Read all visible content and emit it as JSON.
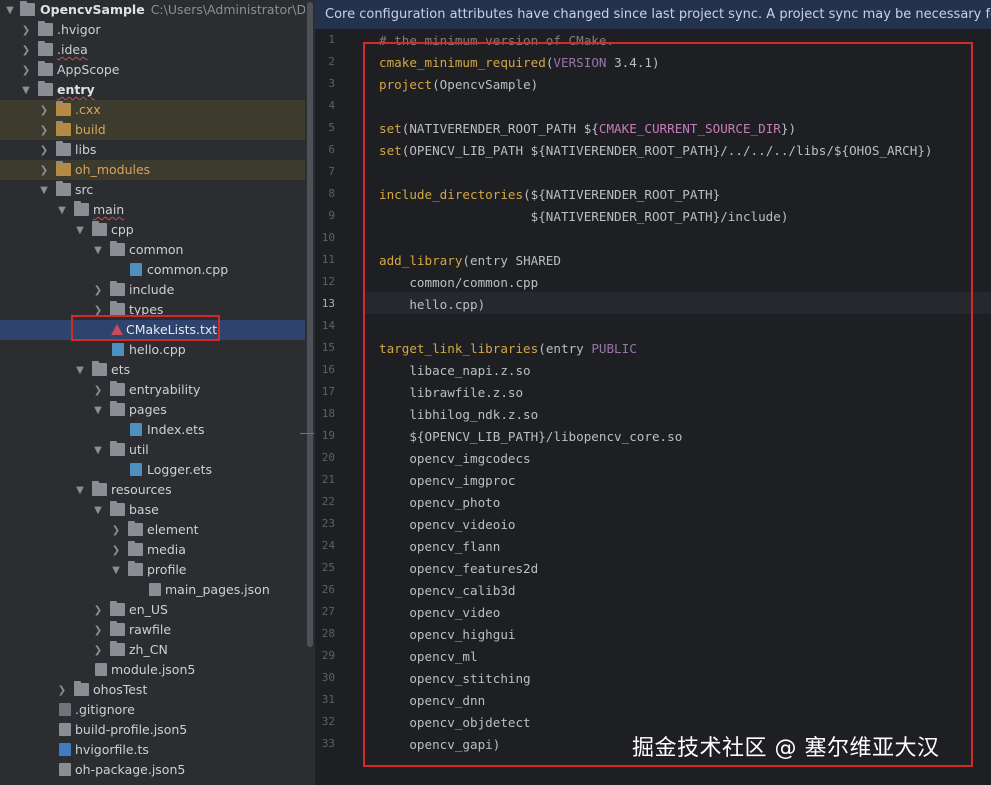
{
  "project_tree": {
    "root": {
      "name": "OpencvSample",
      "path": "C:\\Users\\Administrator\\DevEco"
    },
    "items": [
      {
        "label": ".hvigor"
      },
      {
        "label": ".idea"
      },
      {
        "label": "AppScope"
      },
      {
        "label": "entry"
      },
      {
        "label": ".cxx"
      },
      {
        "label": "build"
      },
      {
        "label": "libs"
      },
      {
        "label": "oh_modules"
      },
      {
        "label": "src"
      },
      {
        "label": "main"
      },
      {
        "label": "cpp"
      },
      {
        "label": "common"
      },
      {
        "label": "common.cpp"
      },
      {
        "label": "include"
      },
      {
        "label": "types"
      },
      {
        "label": "CMakeLists.txt"
      },
      {
        "label": "hello.cpp"
      },
      {
        "label": "ets"
      },
      {
        "label": "entryability"
      },
      {
        "label": "pages"
      },
      {
        "label": "Index.ets"
      },
      {
        "label": "util"
      },
      {
        "label": "Logger.ets"
      },
      {
        "label": "resources"
      },
      {
        "label": "base"
      },
      {
        "label": "element"
      },
      {
        "label": "media"
      },
      {
        "label": "profile"
      },
      {
        "label": "main_pages.json"
      },
      {
        "label": "en_US"
      },
      {
        "label": "rawfile"
      },
      {
        "label": "zh_CN"
      },
      {
        "label": "module.json5"
      },
      {
        "label": "ohosTest"
      },
      {
        ".gitignore": true,
        "label": ".gitignore"
      },
      {
        "label": "build-profile.json5"
      },
      {
        "label": "hvigorfile.ts"
      },
      {
        "label": "oh-package.json5"
      }
    ]
  },
  "editor": {
    "banner": "Core configuration attributes have changed since last project sync. A project sync may be necessary for the IDE to",
    "current_line": "13",
    "lines": [
      {
        "n": "1",
        "text": "# the minimum version of CMake."
      },
      {
        "n": "2",
        "text": "cmake_minimum_required(VERSION 3.4.1)"
      },
      {
        "n": "3",
        "text": "project(OpencvSample)"
      },
      {
        "n": "4",
        "text": ""
      },
      {
        "n": "5",
        "text": "set(NATIVERENDER_ROOT_PATH ${CMAKE_CURRENT_SOURCE_DIR})"
      },
      {
        "n": "6",
        "text": "set(OPENCV_LIB_PATH ${NATIVERENDER_ROOT_PATH}/../../../libs/${OHOS_ARCH})"
      },
      {
        "n": "7",
        "text": ""
      },
      {
        "n": "8",
        "text": "include_directories(${NATIVERENDER_ROOT_PATH}"
      },
      {
        "n": "9",
        "text": "                    ${NATIVERENDER_ROOT_PATH}/include)"
      },
      {
        "n": "10",
        "text": ""
      },
      {
        "n": "11",
        "text": "add_library(entry SHARED"
      },
      {
        "n": "12",
        "text": "    common/common.cpp"
      },
      {
        "n": "13",
        "text": "    hello.cpp)"
      },
      {
        "n": "14",
        "text": ""
      },
      {
        "n": "15",
        "text": "target_link_libraries(entry PUBLIC"
      },
      {
        "n": "16",
        "text": "    libace_napi.z.so"
      },
      {
        "n": "17",
        "text": "    librawfile.z.so"
      },
      {
        "n": "18",
        "text": "    libhilog_ndk.z.so"
      },
      {
        "n": "19",
        "text": "    ${OPENCV_LIB_PATH}/libopencv_core.so"
      },
      {
        "n": "20",
        "text": "    opencv_imgcodecs"
      },
      {
        "n": "21",
        "text": "    opencv_imgproc"
      },
      {
        "n": "22",
        "text": "    opencv_photo"
      },
      {
        "n": "23",
        "text": "    opencv_videoio"
      },
      {
        "n": "24",
        "text": "    opencv_flann"
      },
      {
        "n": "25",
        "text": "    opencv_features2d"
      },
      {
        "n": "26",
        "text": "    opencv_calib3d"
      },
      {
        "n": "27",
        "text": "    opencv_video"
      },
      {
        "n": "28",
        "text": "    opencv_highgui"
      },
      {
        "n": "29",
        "text": "    opencv_ml"
      },
      {
        "n": "30",
        "text": "    opencv_stitching"
      },
      {
        "n": "31",
        "text": "    opencv_dnn"
      },
      {
        "n": "32",
        "text": "    opencv_objdetect"
      },
      {
        "n": "33",
        "text": "    opencv_gapi)"
      }
    ]
  },
  "watermark": "掘金技术社区 @ 塞尔维亚大汉",
  "colors": {
    "function": "#d4a744",
    "placeholder": "#9876aa",
    "variable": "#c77dbb",
    "comment": "#7a7e85",
    "highlight_box": "#d42a2a",
    "banner_bg": "#25324d",
    "selection": "#2e436e"
  },
  "icons": {
    "folder": "folder-icon",
    "module": "module-folder-icon",
    "cpp_file": "cpp-file-icon",
    "ets_file": "ets-file-icon",
    "json_file": "json-file-icon",
    "ts_file": "ts-file-icon",
    "cmake_file": "cmake-file-icon",
    "expand": "chevron-down-icon",
    "collapse": "chevron-right-icon"
  }
}
